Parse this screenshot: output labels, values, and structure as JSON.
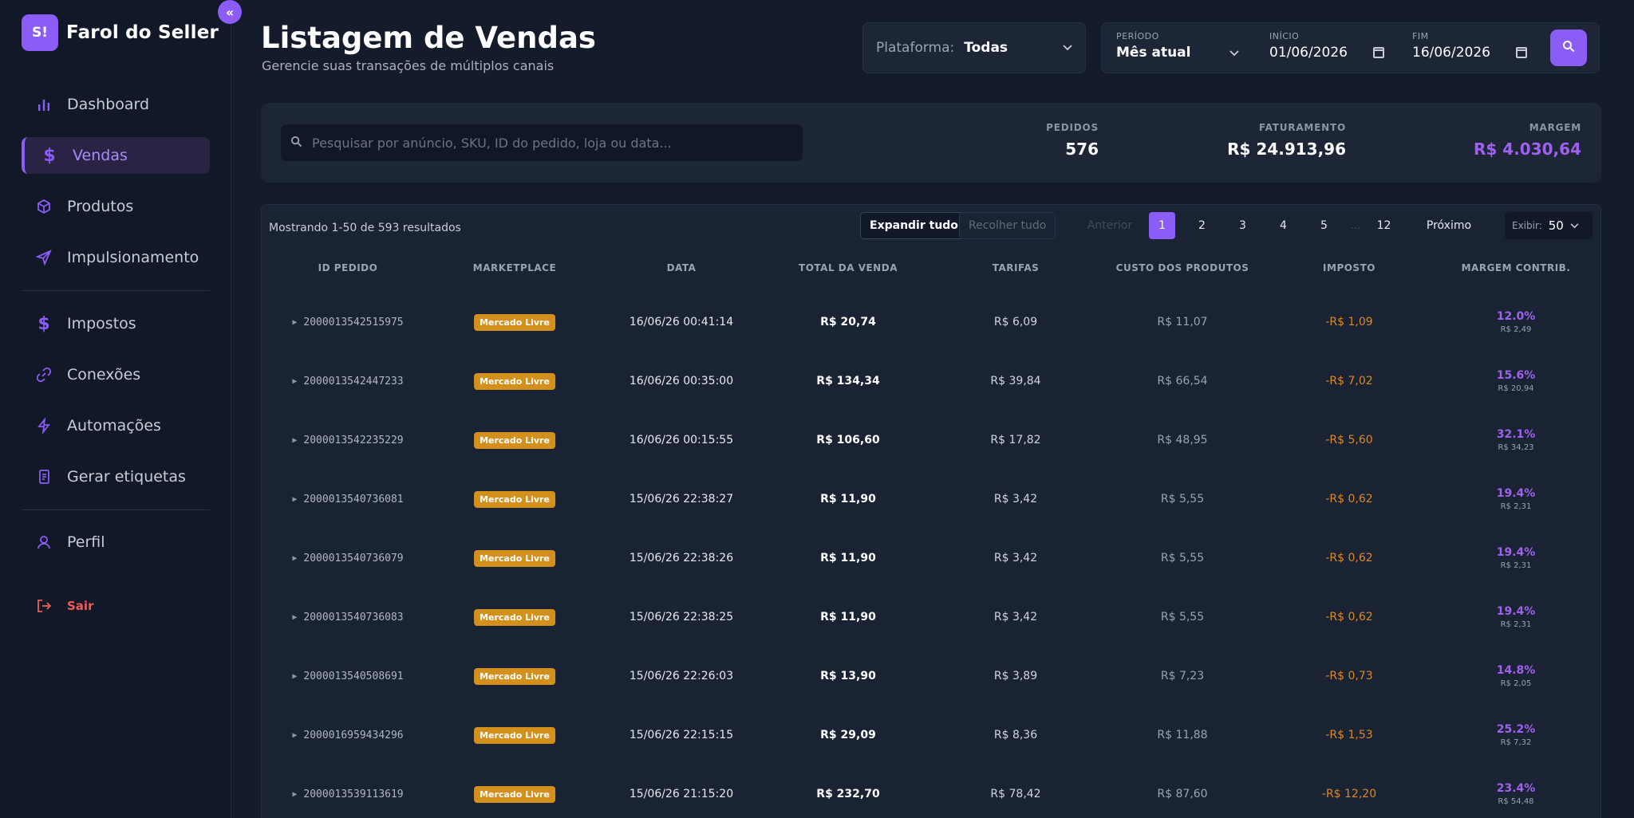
{
  "brand": {
    "logo": "S!",
    "name": "Farol do Seller",
    "collapse_icon": "«"
  },
  "sidebar": {
    "items": [
      {
        "label": "Dashboard",
        "icon": "bar-chart-icon"
      },
      {
        "label": "Vendas",
        "icon": "dollar-icon",
        "active": true
      },
      {
        "label": "Produtos",
        "icon": "box-icon"
      },
      {
        "label": "Impulsionamento",
        "icon": "send-icon"
      },
      {
        "label": "Impostos",
        "icon": "dollar-icon"
      },
      {
        "label": "Conexões",
        "icon": "link-icon"
      },
      {
        "label": "Automações",
        "icon": "bolt-icon"
      },
      {
        "label": "Gerar etiquetas",
        "icon": "document-icon"
      },
      {
        "label": "Perfil",
        "icon": "user-icon"
      }
    ],
    "logout": "Sair"
  },
  "header": {
    "title": "Listagem de Vendas",
    "subtitle": "Gerencie suas transações de múltiplos canais"
  },
  "filters": {
    "platform_label": "Plataforma:",
    "platform_value": "Todas",
    "period_label": "PERÍODO",
    "period_value": "Mês atual",
    "start_label": "INÍCIO",
    "start_value": "01/06/2026",
    "end_label": "FIM",
    "end_value": "16/06/2026"
  },
  "search": {
    "placeholder": "Pesquisar por anúncio, SKU, ID do pedido, loja ou data..."
  },
  "stats": {
    "orders_label": "PEDIDOS",
    "orders_value": "576",
    "revenue_label": "FATURAMENTO",
    "revenue_value": "R$ 24.913,96",
    "margin_label": "MARGEM",
    "margin_value": "R$ 4.030,64"
  },
  "toolbar": {
    "showing": "Mostrando 1-50 de 593 resultados",
    "expand_all": "Expandir tudo",
    "collapse_all": "Recolher tudo",
    "prev": "Anterior",
    "pages": [
      "1",
      "2",
      "3",
      "4",
      "5",
      "...",
      "12"
    ],
    "current_page": "1",
    "next": "Próximo",
    "per_page_label": "Exibir:",
    "per_page_value": "50"
  },
  "table": {
    "columns": [
      "ID PEDIDO",
      "MARKETPLACE",
      "DATA",
      "TOTAL DA VENDA",
      "TARIFAS",
      "CUSTO DOS PRODUTOS",
      "IMPOSTO",
      "MARGEM CONTRIB."
    ],
    "rows": [
      {
        "id": "2000013542515975",
        "marketplace": "Mercado Livre",
        "date": "16/06/26 00:41:14",
        "total": "R$ 20,74",
        "fees": "R$ 6,09",
        "cost": "R$ 11,07",
        "tax": "-R$ 1,09",
        "margin_pct": "12.0%",
        "margin_abs": "R$ 2,49"
      },
      {
        "id": "2000013542447233",
        "marketplace": "Mercado Livre",
        "date": "16/06/26 00:35:00",
        "total": "R$ 134,34",
        "fees": "R$ 39,84",
        "cost": "R$ 66,54",
        "tax": "-R$ 7,02",
        "margin_pct": "15.6%",
        "margin_abs": "R$ 20,94"
      },
      {
        "id": "2000013542235229",
        "marketplace": "Mercado Livre",
        "date": "16/06/26 00:15:55",
        "total": "R$ 106,60",
        "fees": "R$ 17,82",
        "cost": "R$ 48,95",
        "tax": "-R$ 5,60",
        "margin_pct": "32.1%",
        "margin_abs": "R$ 34,23"
      },
      {
        "id": "2000013540736081",
        "marketplace": "Mercado Livre",
        "date": "15/06/26 22:38:27",
        "total": "R$ 11,90",
        "fees": "R$ 3,42",
        "cost": "R$ 5,55",
        "tax": "-R$ 0,62",
        "margin_pct": "19.4%",
        "margin_abs": "R$ 2,31"
      },
      {
        "id": "2000013540736079",
        "marketplace": "Mercado Livre",
        "date": "15/06/26 22:38:26",
        "total": "R$ 11,90",
        "fees": "R$ 3,42",
        "cost": "R$ 5,55",
        "tax": "-R$ 0,62",
        "margin_pct": "19.4%",
        "margin_abs": "R$ 2,31"
      },
      {
        "id": "2000013540736083",
        "marketplace": "Mercado Livre",
        "date": "15/06/26 22:38:25",
        "total": "R$ 11,90",
        "fees": "R$ 3,42",
        "cost": "R$ 5,55",
        "tax": "-R$ 0,62",
        "margin_pct": "19.4%",
        "margin_abs": "R$ 2,31"
      },
      {
        "id": "2000013540508691",
        "marketplace": "Mercado Livre",
        "date": "15/06/26 22:26:03",
        "total": "R$ 13,90",
        "fees": "R$ 3,89",
        "cost": "R$ 7,23",
        "tax": "-R$ 0,73",
        "margin_pct": "14.8%",
        "margin_abs": "R$ 2,05"
      },
      {
        "id": "2000016959434296",
        "marketplace": "Mercado Livre",
        "date": "15/06/26 22:15:15",
        "total": "R$ 29,09",
        "fees": "R$ 8,36",
        "cost": "R$ 11,88",
        "tax": "-R$ 1,53",
        "margin_pct": "25.2%",
        "margin_abs": "R$ 7,32"
      },
      {
        "id": "2000013539113619",
        "marketplace": "Mercado Livre",
        "date": "15/06/26 21:15:20",
        "total": "R$ 232,70",
        "fees": "R$ 78,42",
        "cost": "R$ 87,60",
        "tax": "-R$ 12,20",
        "margin_pct": "23.4%",
        "margin_abs": "R$ 54,48"
      }
    ]
  },
  "colors": {
    "accent": "#8b5cf6",
    "badge": "#d4901c",
    "tax": "#d9892a",
    "logout": "#f05a5a"
  }
}
